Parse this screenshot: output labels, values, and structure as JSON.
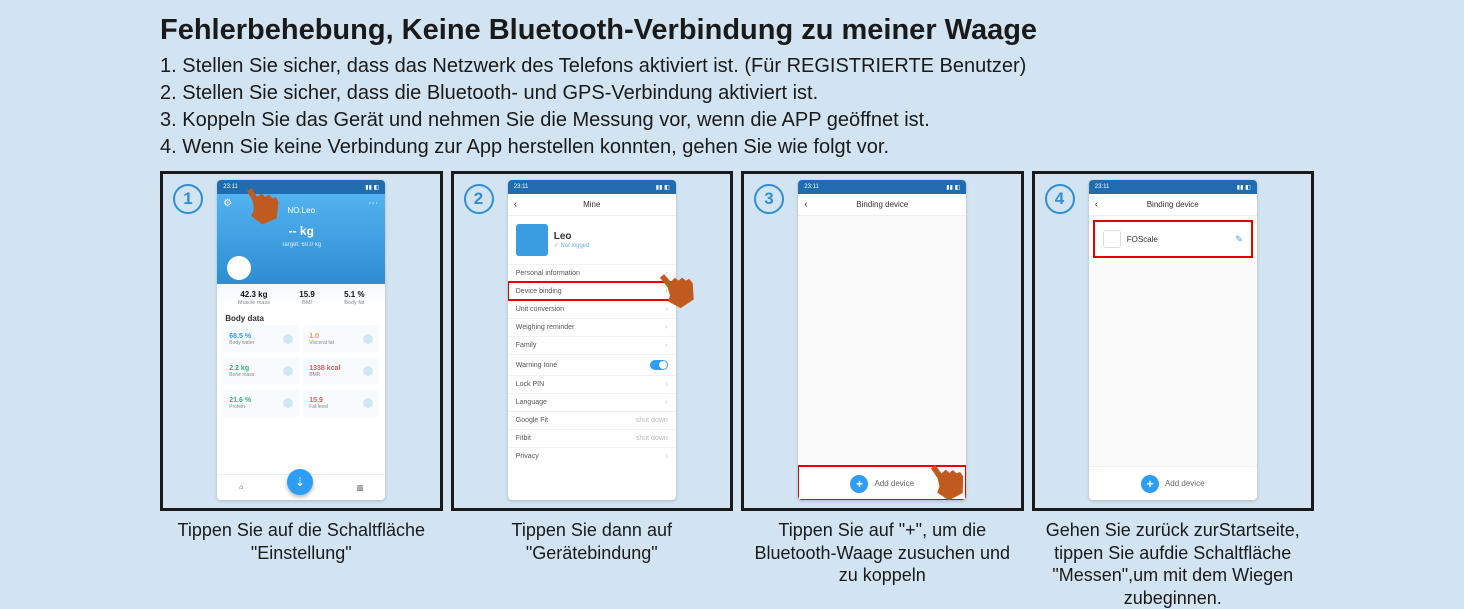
{
  "title": "Fehlerbehebung, Keine Bluetooth-Verbindung zu meiner Waage",
  "intro": [
    "1. Stellen Sie sicher, dass das Netzwerk des Telefons aktiviert ist. (Für REGISTRIERTE Benutzer)",
    "2. Stellen Sie sicher, dass die Bluetooth- und GPS-Verbindung aktiviert ist.",
    "3. Koppeln Sie das Gerät und nehmen Sie die Messung vor, wenn die APP geöffnet ist.",
    "4. Wenn Sie keine Verbindung zur App herstellen konnten, gehen Sie wie folgt vor."
  ],
  "steps": {
    "s1": {
      "num": "1",
      "caption": "Tippen Sie auf die Schaltfläche \"Einstellung\""
    },
    "s2": {
      "num": "2",
      "caption": "Tippen Sie dann auf \"Gerätebindung\""
    },
    "s3": {
      "num": "3",
      "caption": "Tippen Sie auf \"+\", um die Bluetooth-Waage zusuchen und zu koppeln"
    },
    "s4": {
      "num": "4",
      "caption": "Gehen Sie zurück zurStartseite, tippen Sie aufdie Schaltfläche \"Messen\",um mit dem Wiegen zubeginnen."
    }
  },
  "phone": {
    "status_time": "23:11",
    "home": {
      "username": "NO.Leo",
      "weight": "-- kg",
      "weight_sub": "Target: 60.0 kg",
      "metrics": [
        {
          "val": "42.3 kg",
          "lbl": "Muscle mass"
        },
        {
          "val": "15.9",
          "lbl": "BMI"
        },
        {
          "val": "5.1 %",
          "lbl": "Body fat"
        }
      ],
      "body_data_title": "Body data",
      "cells": [
        {
          "val": "68.5 %",
          "lbl": "Body water",
          "color": "#2e9df5"
        },
        {
          "val": "1.0",
          "lbl": "Visceral fat",
          "color": "#f0a030"
        },
        {
          "val": "2.2 kg",
          "lbl": "Bone mass",
          "color": "#35b56a"
        },
        {
          "val": "1338 kcal",
          "lbl": "BMR",
          "color": "#e85a5a"
        },
        {
          "val": "21.6 %",
          "lbl": "Protein",
          "color": "#35b56a"
        },
        {
          "val": "15.9",
          "lbl": "Fat level",
          "color": "#e85a5a"
        }
      ]
    },
    "mine": {
      "title": "Mine",
      "name": "Leo",
      "tag": "✓ Not logged",
      "rows": [
        {
          "label": "Personal information"
        },
        {
          "label": "Device binding",
          "highlight": true
        },
        {
          "label": "Unit conversion"
        },
        {
          "label": "Weighing reminder"
        },
        {
          "label": "Family"
        },
        {
          "label": "Warning tone",
          "toggle": true
        },
        {
          "label": "Lock PIN"
        },
        {
          "label": "Language"
        },
        {
          "label": "Google Fit",
          "right": "shut down"
        },
        {
          "label": "Fitbit",
          "right": "shut down"
        },
        {
          "label": "Privacy"
        }
      ]
    },
    "binding": {
      "title": "Binding device",
      "add_label": "Add device",
      "device_name": "FOScale"
    }
  }
}
